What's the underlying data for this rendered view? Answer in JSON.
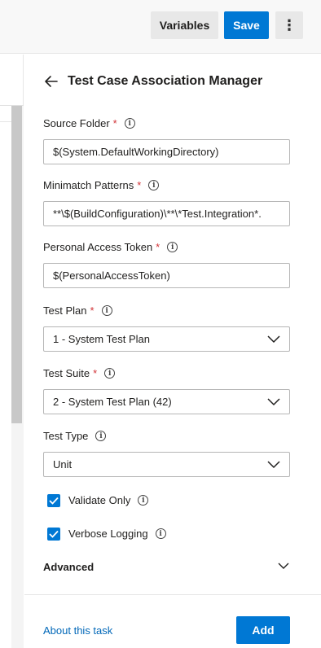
{
  "toolbar": {
    "variables_label": "Variables",
    "save_label": "Save",
    "more_glyph": "⋮"
  },
  "panel": {
    "title": "Test Case Association Manager",
    "fields": {
      "source_folder": {
        "label": "Source Folder",
        "required": "*",
        "value": "$(System.DefaultWorkingDirectory)"
      },
      "minimatch": {
        "label": "Minimatch Patterns",
        "required": "*",
        "value": "**\\$(BuildConfiguration)\\**\\*Test.Integration*."
      },
      "pat": {
        "label": "Personal Access Token",
        "required": "*",
        "value": "$(PersonalAccessToken)"
      },
      "test_plan": {
        "label": "Test Plan",
        "required": "*",
        "value": "1 - System Test Plan"
      },
      "test_suite": {
        "label": "Test Suite",
        "required": "*",
        "value": "2 - System Test Plan (42)"
      },
      "test_type": {
        "label": "Test Type",
        "value": "Unit"
      }
    },
    "checkboxes": {
      "validate_only": {
        "label": "Validate Only",
        "checked": true
      },
      "verbose_logging": {
        "label": "Verbose Logging",
        "checked": true
      }
    },
    "advanced_label": "Advanced",
    "about_link": "About this task",
    "add_label": "Add"
  },
  "icons": {
    "info": "info-circle-icon",
    "back": "arrow-left-icon",
    "chevron": "chevron-down-icon",
    "check": "checkmark-icon",
    "more": "more-vertical-icon"
  },
  "colors": {
    "accent": "#0078d4",
    "required": "#d13438",
    "link": "#0067b8"
  }
}
